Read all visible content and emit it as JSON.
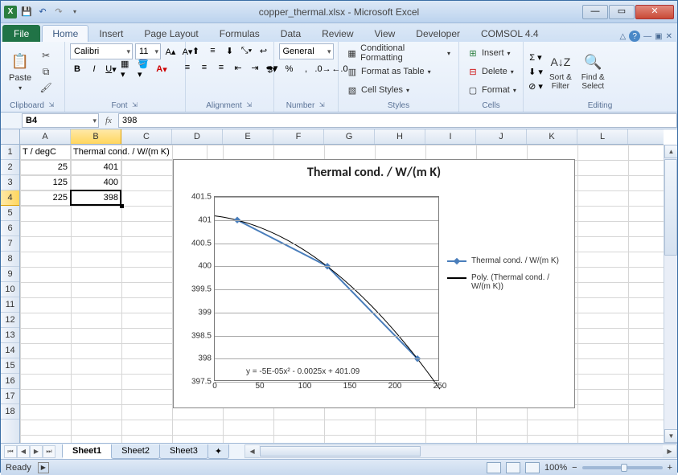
{
  "window": {
    "title": "copper_thermal.xlsx - Microsoft Excel"
  },
  "tabs": {
    "file": "File",
    "list": [
      "Home",
      "Insert",
      "Page Layout",
      "Formulas",
      "Data",
      "Review",
      "View",
      "Developer",
      "COMSOL 4.4"
    ],
    "active": "Home"
  },
  "ribbon": {
    "clipboard": {
      "paste": "Paste",
      "label": "Clipboard"
    },
    "font": {
      "family": "Calibri",
      "size": "11",
      "label": "Font"
    },
    "alignment": {
      "label": "Alignment"
    },
    "number": {
      "format": "General",
      "label": "Number"
    },
    "styles": {
      "cond": "Conditional Formatting",
      "table": "Format as Table",
      "cell": "Cell Styles",
      "label": "Styles"
    },
    "cells": {
      "insert": "Insert",
      "delete": "Delete",
      "format": "Format",
      "label": "Cells"
    },
    "editing": {
      "sort": "Sort &\nFilter",
      "find": "Find &\nSelect",
      "label": "Editing"
    }
  },
  "namebox": "B4",
  "formula": "398",
  "sheet": {
    "columns": [
      "A",
      "B",
      "C",
      "D",
      "E",
      "F",
      "G",
      "H",
      "I",
      "J",
      "K",
      "L"
    ],
    "rows": 18,
    "A1": "T / degC",
    "B1": "Thermal cond. / W/(m K)",
    "A2": "25",
    "B2": "401",
    "A3": "125",
    "B3": "400",
    "A4": "225",
    "B4": "398"
  },
  "chart_data": {
    "type": "line",
    "title": "Thermal cond. / W/(m K)",
    "x": [
      25,
      125,
      225
    ],
    "series": [
      {
        "name": "Thermal cond. / W/(m K)",
        "values": [
          401,
          400,
          398
        ],
        "kind": "line-marker"
      },
      {
        "name": "Poly. (Thermal cond. / W/(m K))",
        "kind": "trendline"
      }
    ],
    "xlim": [
      0,
      250
    ],
    "xticks": [
      0,
      50,
      100,
      150,
      200,
      250
    ],
    "ylim": [
      397.5,
      401.5
    ],
    "yticks": [
      397.5,
      398,
      398.5,
      399,
      399.5,
      400,
      400.5,
      401,
      401.5
    ],
    "equation": "y = -5E-05x² - 0.0025x + 401.09"
  },
  "tabs_bottom": {
    "sheets": [
      "Sheet1",
      "Sheet2",
      "Sheet3"
    ],
    "active": "Sheet1"
  },
  "status": {
    "ready": "Ready",
    "zoom": "100%"
  }
}
